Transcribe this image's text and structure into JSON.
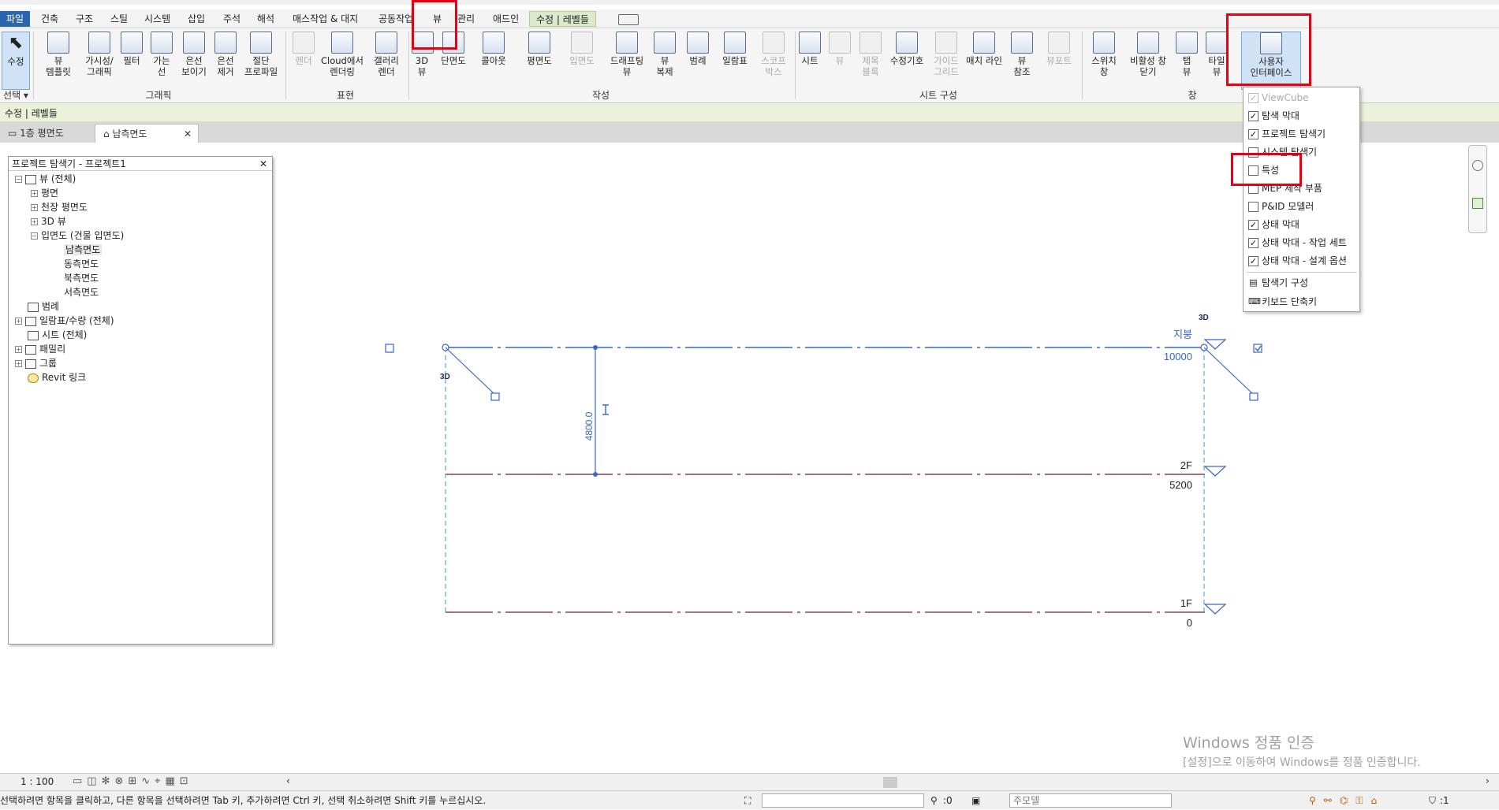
{
  "ribbon_tabs": [
    "파일",
    "건축",
    "구조",
    "스틸",
    "시스템",
    "삽입",
    "주석",
    "해석",
    "매스작업 & 대지",
    "공동작업",
    "뷰",
    "관리",
    "애드인",
    "수정 | 레벨들"
  ],
  "ribbon_buttons": {
    "modify": "수정",
    "view_templates": "뷰\n템플릿",
    "visibility": "가시성/\n그래픽",
    "filters": "필터",
    "thin_lines": "가는\n선",
    "show_hidden": "은선\n보이기",
    "remove_hidden": "은선\n제거",
    "cut_profile": "절단\n프로파일",
    "render": "렌더",
    "cloud_render": "Cloud에서\n렌더링",
    "gallery": "갤러리\n렌더",
    "view_3d": "3D\n뷰",
    "section": "단면도",
    "callout": "콜아웃",
    "plan": "평면도",
    "elevation": "입면도",
    "drafting": "드래프팅\n뷰",
    "duplicate": "뷰\n복제",
    "legend": "범례",
    "schedules": "일람표",
    "scope_box": "스코프\n박스",
    "sheet": "시트",
    "view_btn": "뷰",
    "title_block": "제목\n블록",
    "revisions": "수정기호",
    "guide_grid": "가이드\n그리드",
    "matchline": "매치 라인",
    "view_ref": "뷰\n참조",
    "viewports": "뷰포트",
    "switch_window": "스위치\n창",
    "close_inactive": "비활성 창\n닫기",
    "tab_views": "탭\n뷰",
    "tile_views": "타일\n뷰",
    "user_interface": "사용자\n인터페이스"
  },
  "ribbon_groups": {
    "select": "선택 ▾",
    "graphics": "그래픽",
    "presentation": "표현",
    "create": "작성",
    "sheet": "시트 구성",
    "window": "창"
  },
  "context_bar": "수정 | 레벨들",
  "view_tabs": [
    {
      "label": "1층 평면도"
    },
    {
      "label": "남측면도"
    }
  ],
  "project_browser": {
    "title": "프로젝트 탐색기 - 프로젝트1",
    "nodes": [
      "뷰 (전체)",
      "평면",
      "천장 평면도",
      "3D 뷰",
      "입면도 (건물 입면도)",
      "남측면도",
      "동측면도",
      "북측면도",
      "서측면도",
      "범례",
      "일람표/수량 (전체)",
      "시트 (전체)",
      "패밀리",
      "그룹",
      "Revit 링크"
    ]
  },
  "ui_menu": {
    "items": [
      {
        "label": "ViewCube",
        "checked": true,
        "disabled": true
      },
      {
        "label": "탐색 막대",
        "checked": true
      },
      {
        "label": "프로젝트 탐색기",
        "checked": true
      },
      {
        "label": "시스템 탐색기",
        "checked": false
      },
      {
        "label": "특성",
        "checked": false
      },
      {
        "label": "MEP 제작 부품",
        "checked": false
      },
      {
        "label": "P&ID 모델러",
        "checked": false
      },
      {
        "label": "상태 막대",
        "checked": true
      },
      {
        "label": "상태 막대 - 작업 세트",
        "checked": true
      },
      {
        "label": "상태 막대 - 설계 옵션",
        "checked": true
      }
    ],
    "browser_org": "탐색기 구성",
    "shortcuts": "키보드 단축키"
  },
  "levels": [
    {
      "name": "지붕",
      "elevation": "10000"
    },
    {
      "name": "2F",
      "elevation": "5200"
    },
    {
      "name": "1F",
      "elevation": "0"
    }
  ],
  "dimension": "4800.0",
  "tag_3d": "3D",
  "scale": "1 : 100",
  "status_message": "선택하려면 항목을 클릭하고, 다른 항목을 선택하려면 Tab 키, 추가하려면 Ctrl 키, 선택 취소하려면 Shift 키를 누르십시오.",
  "status_zero": ":0",
  "status_model": "주모델",
  "status_filter": ":1",
  "watermark": {
    "line1": "Windows 정품 인증",
    "line2": "[설정]으로 이동하여 Windows를 정품 인증합니다."
  },
  "accent": "#2a66b0",
  "highlight": "#e60012"
}
